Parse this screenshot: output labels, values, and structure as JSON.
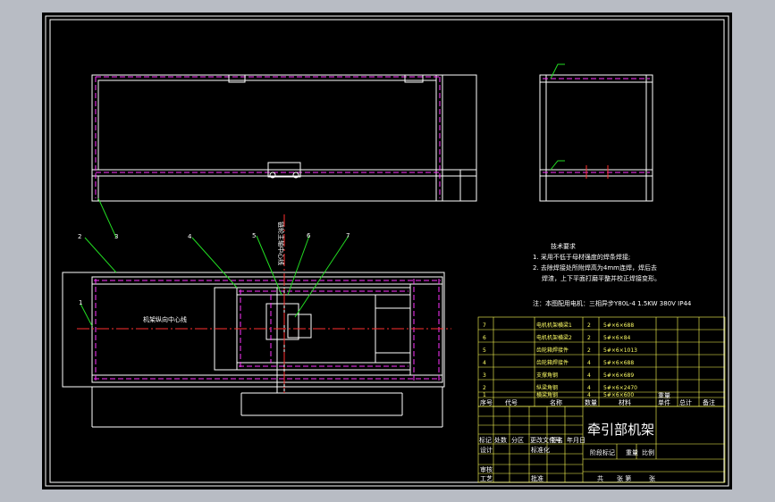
{
  "window": {
    "colors": {
      "background": "#b8bcc4",
      "sheet": "#000000",
      "frame": "#ffffff",
      "hidden_line": "#ff33ff",
      "center_line": "#ff3030",
      "leader": "#22dd22",
      "table_text": "#ffff55"
    }
  },
  "drawing": {
    "title": "牵引部机架",
    "tech_heading": "技术要求",
    "tech_req_1": "1. 采用不低于母材强度的焊条焊接;",
    "tech_req_2a": "2. 去除焊接处所附焊高为4mm连焊，焊后去",
    "tech_req_2b": "焊渣，上下平面打磨平整并校正焊接变形。",
    "note": "注：本图配用电机：三相异步Y80L-4 1.5KW 380V IP44",
    "label_horizontal_center": "机架纵向中心线",
    "label_vertical_center": "链轮主轴中心线",
    "balloons": [
      "1",
      "2",
      "3",
      "4",
      "5",
      "6",
      "7"
    ],
    "bom": [
      {
        "no": "7",
        "name": "电机机架横梁1",
        "qty": "2",
        "material": "5#×6×688"
      },
      {
        "no": "6",
        "name": "电机机架横梁2",
        "qty": "2",
        "material": "5#×6×84"
      },
      {
        "no": "5",
        "name": "齿轮箱焊接件",
        "qty": "2",
        "material": "5#×6×1013"
      },
      {
        "no": "4",
        "name": "齿轮箱焊接件",
        "qty": "4",
        "material": "5#×6×688"
      },
      {
        "no": "3",
        "name": "支撑角钢",
        "qty": "4",
        "material": "5#×6×689"
      },
      {
        "no": "2",
        "name": "纵梁角钢",
        "qty": "4",
        "material": "5#×6×2470"
      },
      {
        "no": "1",
        "name": "横梁角钢",
        "qty": "4",
        "material": "5#×6×600"
      }
    ],
    "bom_header": [
      "序号",
      "代号",
      "名称",
      "数量",
      "材料",
      "单件",
      "总计",
      "备注"
    ],
    "bom_header_mass": "重量",
    "title_block": {
      "rev_row": [
        "标记",
        "处数",
        "分区",
        "更改文件号",
        "签名",
        "年月日"
      ],
      "design": "设计",
      "standard": "标准化",
      "review": "审核",
      "process": "工艺",
      "approve": "批准",
      "stage_mark": "阶段标记",
      "weight": "重量",
      "scale": "比例",
      "sheets": "共",
      "sheet_no": "张  第",
      "sheet_end": "张"
    }
  }
}
